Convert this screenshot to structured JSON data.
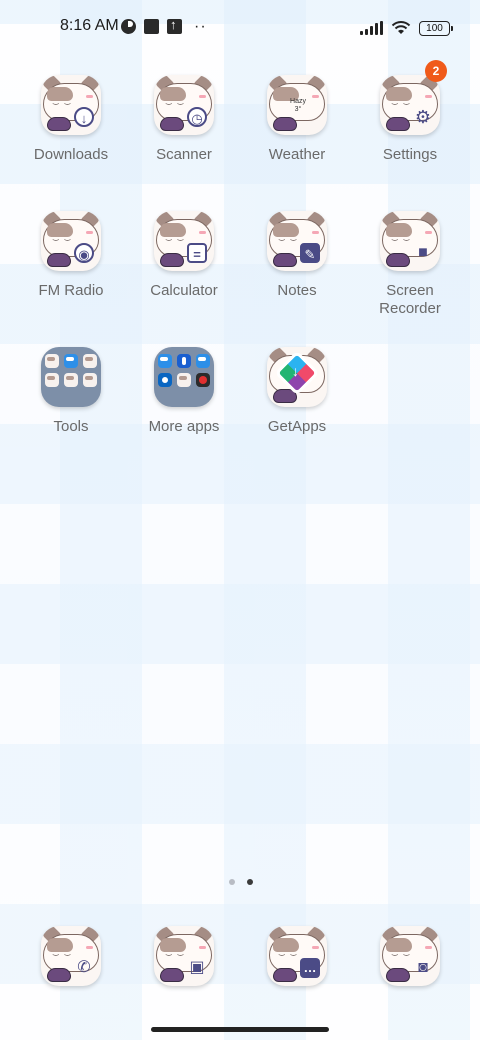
{
  "status_bar": {
    "time": "8:16 AM",
    "battery": "100",
    "icons": [
      "sync-icon",
      "square-icon",
      "upload-icon",
      "more-dots-icon",
      "signal-icon",
      "wifi-icon",
      "battery-icon"
    ]
  },
  "apps": [
    {
      "label": "Downloads",
      "icon": "downloads-icon",
      "glyph": "↓"
    },
    {
      "label": "Scanner",
      "icon": "scanner-icon",
      "glyph": "◷"
    },
    {
      "label": "Weather",
      "icon": "weather-icon",
      "glyph": "",
      "weather_text": "Hazy 3°"
    },
    {
      "label": "Settings",
      "icon": "settings-icon",
      "glyph": "⚙",
      "badge": "2"
    },
    {
      "label": "FM Radio",
      "icon": "fm-radio-icon",
      "glyph": "◉"
    },
    {
      "label": "Calculator",
      "icon": "calculator-icon",
      "glyph": "="
    },
    {
      "label": "Notes",
      "icon": "notes-icon",
      "glyph": "✎"
    },
    {
      "label": "Screen Recorder",
      "icon": "screen-recorder-icon",
      "glyph": "■"
    },
    {
      "label": "Tools",
      "icon": "tools-folder-icon"
    },
    {
      "label": "More apps",
      "icon": "more-apps-folder-icon"
    },
    {
      "label": "GetApps",
      "icon": "getapps-icon"
    }
  ],
  "dock": [
    {
      "icon": "phone-icon",
      "glyph": "✆"
    },
    {
      "icon": "gallery-icon",
      "glyph": "▣"
    },
    {
      "icon": "messages-icon",
      "glyph": "…"
    },
    {
      "icon": "camera-icon",
      "glyph": "◙"
    }
  ],
  "pages": {
    "count": 2,
    "active": 2
  },
  "colors": {
    "badge": "#f05a1a",
    "label": "#6a6a6a",
    "folder": "#7d8fa8"
  }
}
